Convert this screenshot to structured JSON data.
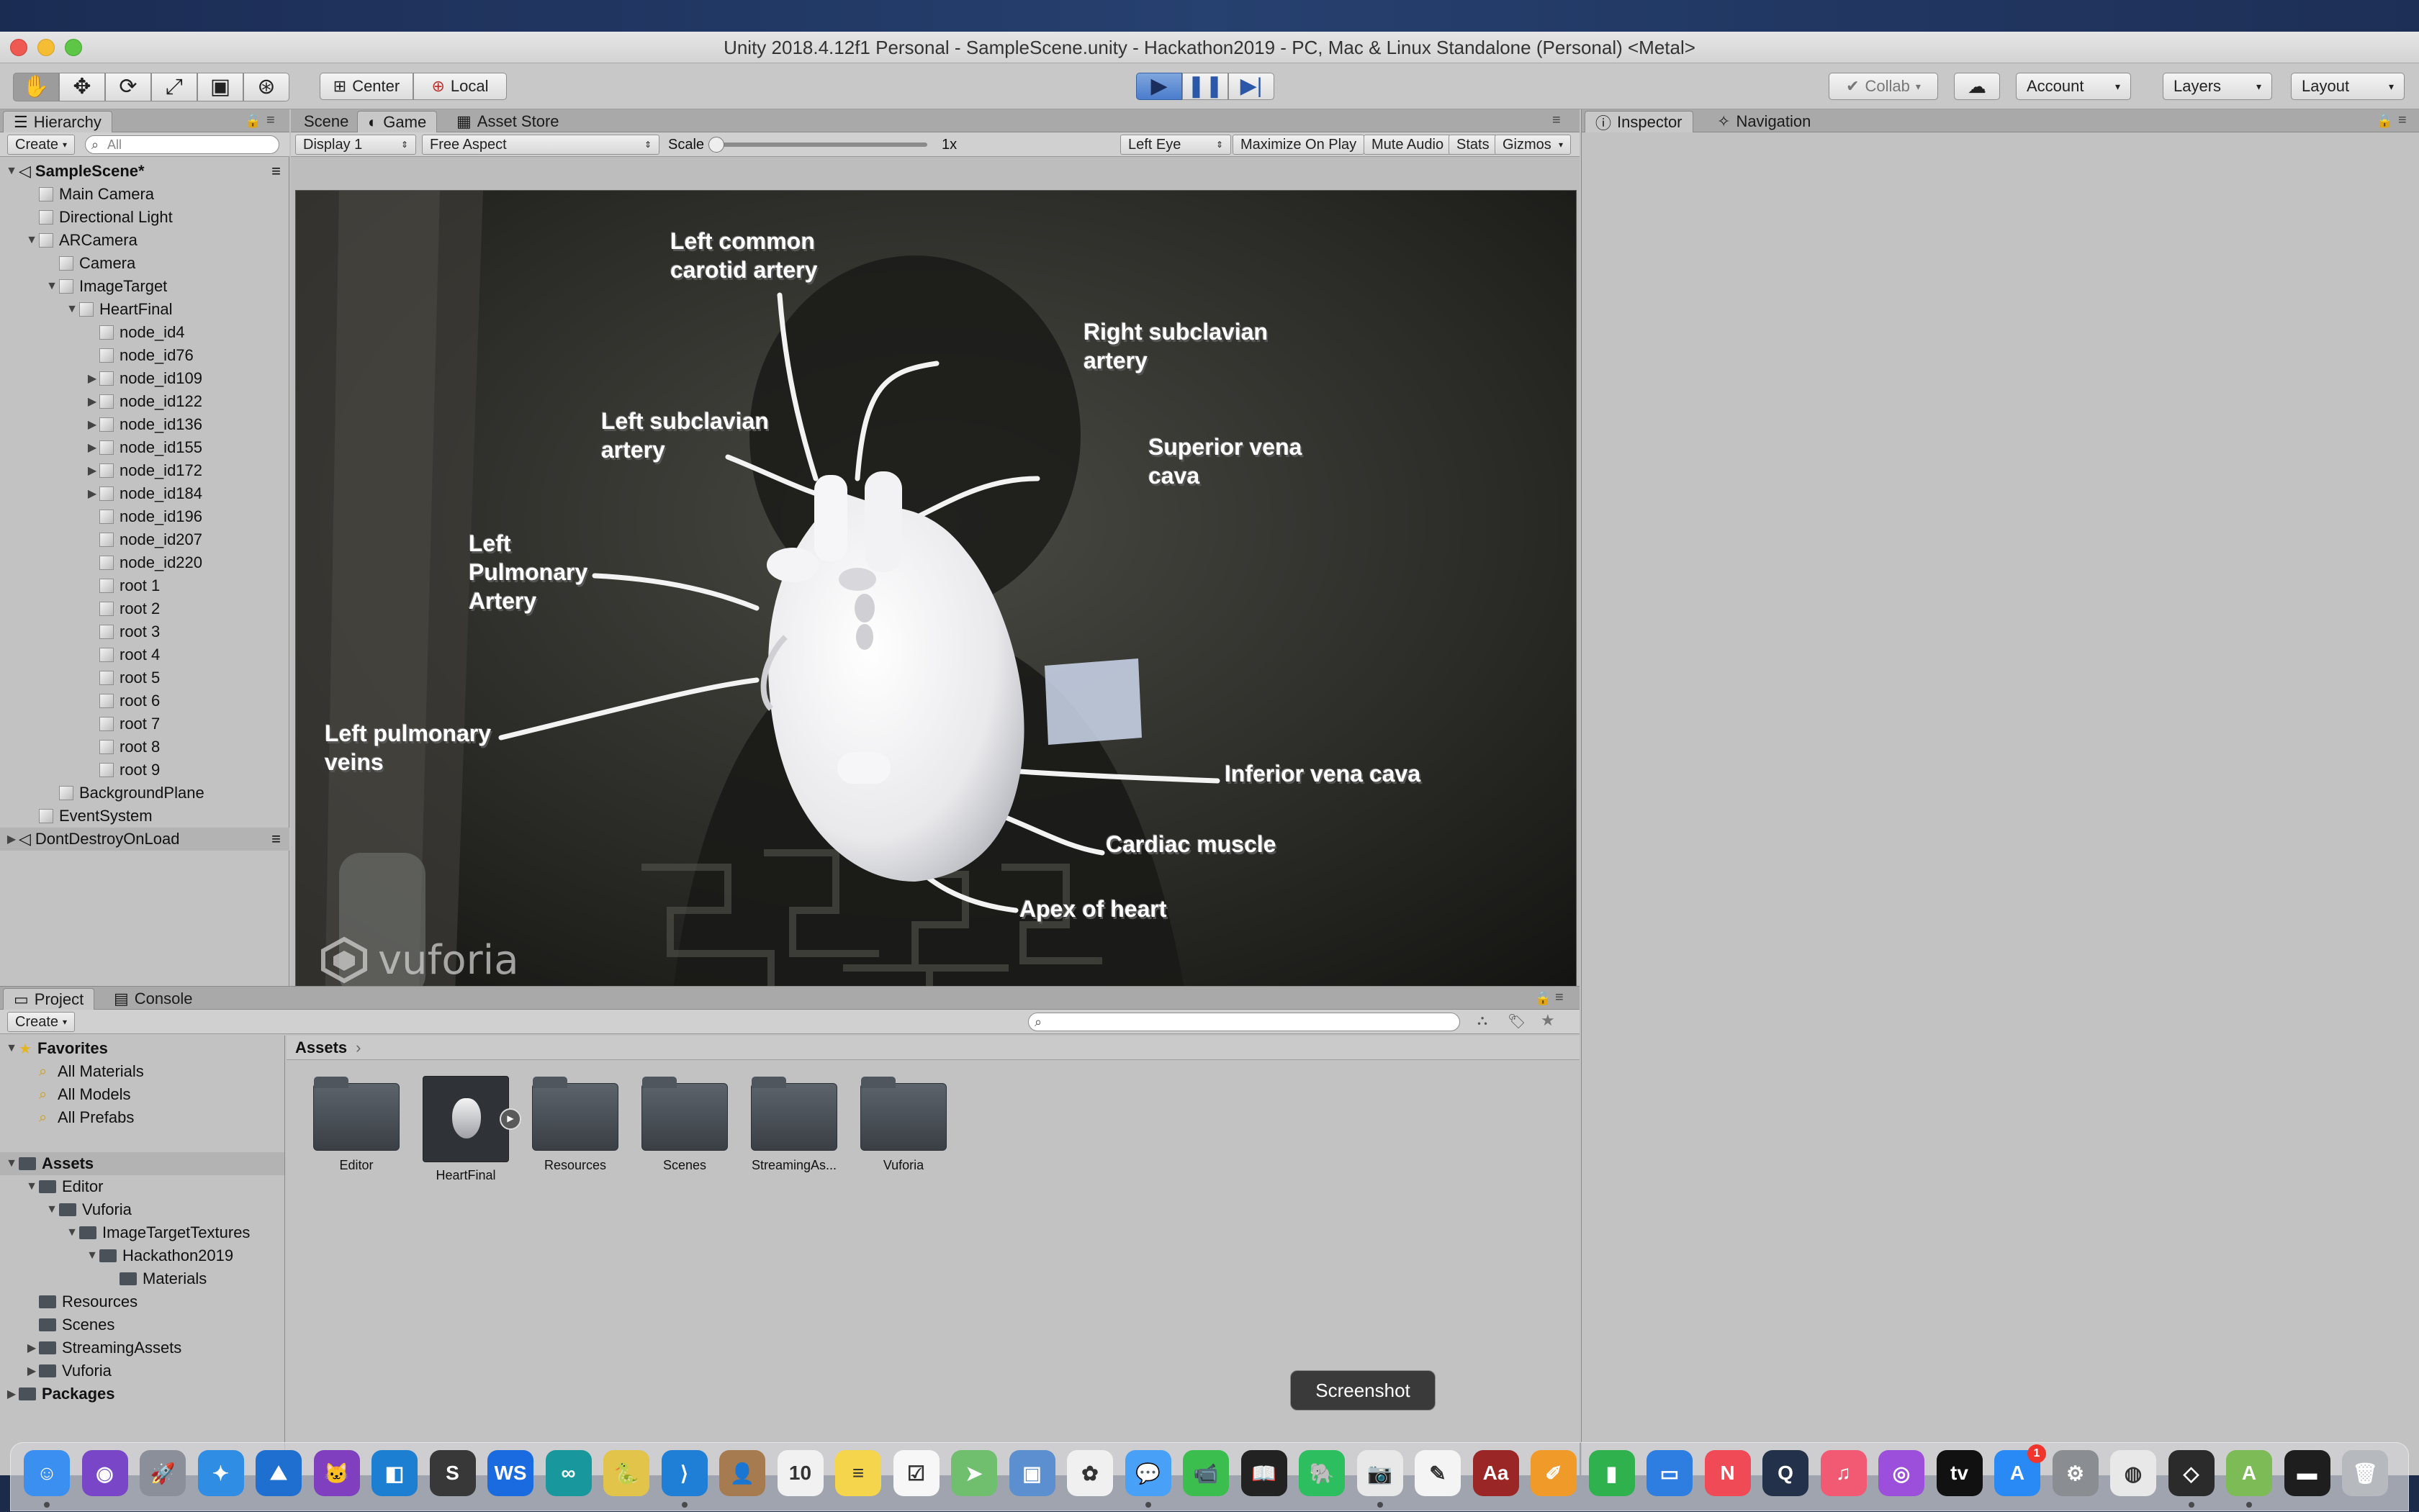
{
  "window": {
    "title": "Unity 2018.4.12f1 Personal - SampleScene.unity - Hackathon2019 - PC, Mac & Linux Standalone (Personal) <Metal>"
  },
  "toolbar": {
    "transform_tools": [
      "hand-icon",
      "move-icon",
      "rotate-icon",
      "scale-icon",
      "rect-icon",
      "transform-icon"
    ],
    "pivot_label": "Center",
    "space_label": "Local",
    "collab_label": "Collab",
    "account_label": "Account",
    "layers_label": "Layers",
    "layout_label": "Layout",
    "play_state": "playing"
  },
  "hierarchy": {
    "tab": "Hierarchy",
    "create": "Create",
    "search_placeholder": "All",
    "items": [
      {
        "label": "SampleScene*",
        "depth": 0,
        "arrow": "▼",
        "kind": "scene",
        "bold": true
      },
      {
        "label": "Main Camera",
        "depth": 1,
        "arrow": "",
        "kind": "cube"
      },
      {
        "label": "Directional Light",
        "depth": 1,
        "arrow": "",
        "kind": "cube"
      },
      {
        "label": "ARCamera",
        "depth": 1,
        "arrow": "▼",
        "kind": "cube"
      },
      {
        "label": "Camera",
        "depth": 2,
        "arrow": "",
        "kind": "cube"
      },
      {
        "label": "ImageTarget",
        "depth": 2,
        "arrow": "▼",
        "kind": "cube"
      },
      {
        "label": "HeartFinal",
        "depth": 3,
        "arrow": "▼",
        "kind": "cube"
      },
      {
        "label": "node_id4",
        "depth": 4,
        "arrow": "",
        "kind": "cube"
      },
      {
        "label": "node_id76",
        "depth": 4,
        "arrow": "",
        "kind": "cube"
      },
      {
        "label": "node_id109",
        "depth": 4,
        "arrow": "▶",
        "kind": "cube"
      },
      {
        "label": "node_id122",
        "depth": 4,
        "arrow": "▶",
        "kind": "cube"
      },
      {
        "label": "node_id136",
        "depth": 4,
        "arrow": "▶",
        "kind": "cube"
      },
      {
        "label": "node_id155",
        "depth": 4,
        "arrow": "▶",
        "kind": "cube"
      },
      {
        "label": "node_id172",
        "depth": 4,
        "arrow": "▶",
        "kind": "cube"
      },
      {
        "label": "node_id184",
        "depth": 4,
        "arrow": "▶",
        "kind": "cube"
      },
      {
        "label": "node_id196",
        "depth": 4,
        "arrow": "",
        "kind": "cube"
      },
      {
        "label": "node_id207",
        "depth": 4,
        "arrow": "",
        "kind": "cube"
      },
      {
        "label": "node_id220",
        "depth": 4,
        "arrow": "",
        "kind": "cube"
      },
      {
        "label": "root 1",
        "depth": 4,
        "arrow": "",
        "kind": "cube"
      },
      {
        "label": "root 2",
        "depth": 4,
        "arrow": "",
        "kind": "cube"
      },
      {
        "label": "root 3",
        "depth": 4,
        "arrow": "",
        "kind": "cube"
      },
      {
        "label": "root 4",
        "depth": 4,
        "arrow": "",
        "kind": "cube"
      },
      {
        "label": "root 5",
        "depth": 4,
        "arrow": "",
        "kind": "cube"
      },
      {
        "label": "root 6",
        "depth": 4,
        "arrow": "",
        "kind": "cube"
      },
      {
        "label": "root 7",
        "depth": 4,
        "arrow": "",
        "kind": "cube"
      },
      {
        "label": "root 8",
        "depth": 4,
        "arrow": "",
        "kind": "cube"
      },
      {
        "label": "root 9",
        "depth": 4,
        "arrow": "",
        "kind": "cube"
      },
      {
        "label": "BackgroundPlane",
        "depth": 2,
        "arrow": "",
        "kind": "cube"
      },
      {
        "label": "EventSystem",
        "depth": 1,
        "arrow": "",
        "kind": "cube"
      },
      {
        "label": "DontDestroyOnLoad",
        "depth": 0,
        "arrow": "▶",
        "kind": "scene",
        "selected": true
      }
    ]
  },
  "center": {
    "tabs": [
      {
        "label": "Scene",
        "icon": "",
        "active": false
      },
      {
        "label": "Game",
        "icon": "game-icon",
        "active": true
      },
      {
        "label": "Asset Store",
        "icon": "store-icon",
        "active": false
      }
    ],
    "game_bar": {
      "display": "Display 1",
      "aspect": "Free Aspect",
      "scale_label": "Scale",
      "scale_value": "1x",
      "eye": "Left Eye",
      "maximize": "Maximize On Play",
      "mute": "Mute Audio",
      "stats": "Stats",
      "gizmos": "Gizmos"
    }
  },
  "game_labels": [
    {
      "text": "Left common\ncarotid artery"
    },
    {
      "text": "Right subclavian\nartery"
    },
    {
      "text": "Left subclavian\nartery"
    },
    {
      "text": "Superior vena\ncava"
    },
    {
      "text": "Left\nPulmonary\nArtery"
    },
    {
      "text": "Left pulmonary\nveins"
    },
    {
      "text": "Inferior vena cava"
    },
    {
      "text": "Cardiac muscle"
    },
    {
      "text": "Apex of heart"
    }
  ],
  "watermark": "vuforia",
  "inspector": {
    "tabs": [
      {
        "label": "Inspector",
        "icon": "info-icon",
        "active": true
      },
      {
        "label": "Navigation",
        "icon": "navigation-icon",
        "active": false
      }
    ]
  },
  "project": {
    "tabs": [
      {
        "label": "Project",
        "active": true
      },
      {
        "label": "Console",
        "active": false
      }
    ],
    "create": "Create",
    "tree": [
      {
        "label": "Favorites",
        "depth": 0,
        "arrow": "▼",
        "kind": "star",
        "bold": true
      },
      {
        "label": "All Materials",
        "depth": 1,
        "arrow": "",
        "kind": "search"
      },
      {
        "label": "All Models",
        "depth": 1,
        "arrow": "",
        "kind": "search"
      },
      {
        "label": "All Prefabs",
        "depth": 1,
        "arrow": "",
        "kind": "search"
      },
      {
        "label": "",
        "depth": 0,
        "arrow": "",
        "kind": "spacer"
      },
      {
        "label": "Assets",
        "depth": 0,
        "arrow": "▼",
        "kind": "folder",
        "bold": true,
        "selected": true
      },
      {
        "label": "Editor",
        "depth": 1,
        "arrow": "▼",
        "kind": "folder"
      },
      {
        "label": "Vuforia",
        "depth": 2,
        "arrow": "▼",
        "kind": "folder"
      },
      {
        "label": "ImageTargetTextures",
        "depth": 3,
        "arrow": "▼",
        "kind": "folder"
      },
      {
        "label": "Hackathon2019",
        "depth": 4,
        "arrow": "▼",
        "kind": "folder"
      },
      {
        "label": "Materials",
        "depth": 5,
        "arrow": "",
        "kind": "folder"
      },
      {
        "label": "Resources",
        "depth": 1,
        "arrow": "",
        "kind": "folder"
      },
      {
        "label": "Scenes",
        "depth": 1,
        "arrow": "",
        "kind": "folder"
      },
      {
        "label": "StreamingAssets",
        "depth": 1,
        "arrow": "▶",
        "kind": "folder"
      },
      {
        "label": "Vuforia",
        "depth": 1,
        "arrow": "▶",
        "kind": "folder"
      },
      {
        "label": "Packages",
        "depth": 0,
        "arrow": "▶",
        "kind": "folder",
        "bold": true
      }
    ],
    "breadcrumb": "Assets",
    "assets": [
      {
        "label": "Editor",
        "kind": "folder"
      },
      {
        "label": "HeartFinal",
        "kind": "model"
      },
      {
        "label": "Resources",
        "kind": "folder"
      },
      {
        "label": "Scenes",
        "kind": "folder"
      },
      {
        "label": "StreamingAs...",
        "kind": "folder"
      },
      {
        "label": "Vuforia",
        "kind": "folder"
      }
    ]
  },
  "dock": {
    "tooltip": "Screenshot",
    "apps": [
      {
        "name": "finder-icon",
        "color": "#3b8ff0",
        "glyph": "☺"
      },
      {
        "name": "siri-icon",
        "color": "#7a46c8",
        "glyph": "◉"
      },
      {
        "name": "launchpad-icon",
        "color": "#8a8f99",
        "glyph": "🚀"
      },
      {
        "name": "safari-icon",
        "color": "#2f8de4",
        "glyph": "✦"
      },
      {
        "name": "sourcetree-icon",
        "color": "#1f6fd1",
        "glyph": "⛰"
      },
      {
        "name": "github-desktop-icon",
        "color": "#7f3fbf",
        "glyph": "🐱"
      },
      {
        "name": "tool-icon",
        "color": "#1d7fd1",
        "glyph": "◧"
      },
      {
        "name": "sublime-text-icon",
        "color": "#383838",
        "glyph": "S"
      },
      {
        "name": "webstorm-icon",
        "color": "#1a6be0",
        "glyph": "WS"
      },
      {
        "name": "arduino-icon",
        "color": "#18989c",
        "glyph": "∞"
      },
      {
        "name": "python-launcher-icon",
        "color": "#e2c44a",
        "glyph": "🐍"
      },
      {
        "name": "vscode-icon",
        "color": "#1f7fd6",
        "glyph": "⟩"
      },
      {
        "name": "contacts-icon",
        "color": "#a57b4f",
        "glyph": "👤"
      },
      {
        "name": "calendar-icon",
        "color": "#f1f1f1",
        "glyph": "10"
      },
      {
        "name": "notes-icon",
        "color": "#f5d54b",
        "glyph": "≡"
      },
      {
        "name": "reminders-icon",
        "color": "#f7f7f7",
        "glyph": "☑"
      },
      {
        "name": "maps-icon",
        "color": "#6fbf6f",
        "glyph": "➤"
      },
      {
        "name": "preview-icon",
        "color": "#5b8fd0",
        "glyph": "▣"
      },
      {
        "name": "photos-icon",
        "color": "#f0f0f0",
        "glyph": "✿"
      },
      {
        "name": "messages-icon",
        "color": "#49a0f7",
        "glyph": "💬"
      },
      {
        "name": "facetime-icon",
        "color": "#3cbe4e",
        "glyph": "📹"
      },
      {
        "name": "kindle-icon",
        "color": "#222222",
        "glyph": "📖"
      },
      {
        "name": "evernote-icon",
        "color": "#2dbe60",
        "glyph": "🐘"
      },
      {
        "name": "screenshot-icon",
        "color": "#e8e8e8",
        "glyph": "📷"
      },
      {
        "name": "textedit-icon",
        "color": "#f4f4f4",
        "glyph": "✎"
      },
      {
        "name": "dictionary-icon",
        "color": "#9b2626",
        "glyph": "Aa"
      },
      {
        "name": "pages-icon",
        "color": "#f09a2a",
        "glyph": "✐"
      },
      {
        "name": "numbers-icon",
        "color": "#2fb24d",
        "glyph": "▮"
      },
      {
        "name": "keynote-icon",
        "color": "#2d7ee0",
        "glyph": "▭"
      },
      {
        "name": "news-icon",
        "color": "#f04a56",
        "glyph": "N"
      },
      {
        "name": "quicktime-icon",
        "color": "#23324a",
        "glyph": "Q"
      },
      {
        "name": "music-icon",
        "color": "#f25a73",
        "glyph": "♫"
      },
      {
        "name": "podcasts-icon",
        "color": "#9b4fdb",
        "glyph": "◎"
      },
      {
        "name": "apple-tv-icon",
        "color": "#111111",
        "glyph": "tv"
      },
      {
        "name": "app-store-icon",
        "color": "#2a8af5",
        "glyph": "A"
      },
      {
        "name": "system-preferences-icon",
        "color": "#8a8d92",
        "glyph": "⚙"
      },
      {
        "name": "chrome-icon",
        "color": "#e8e8e8",
        "glyph": "◍"
      },
      {
        "name": "unity-icon",
        "color": "#2b2b2b",
        "glyph": "◇"
      },
      {
        "name": "android-studio-icon",
        "color": "#7dbb56",
        "glyph": "A"
      },
      {
        "name": "terminal-icon",
        "color": "#1e1e1e",
        "glyph": "▬"
      },
      {
        "name": "trash-icon",
        "color": "#b6b9be",
        "glyph": "🗑"
      }
    ],
    "badge": "1"
  },
  "colors": {
    "panel": "#c2c2c2",
    "tab_row": "#a9a9a9",
    "play_accent": "#4b7ccc",
    "selection": "#b3b3b3"
  }
}
